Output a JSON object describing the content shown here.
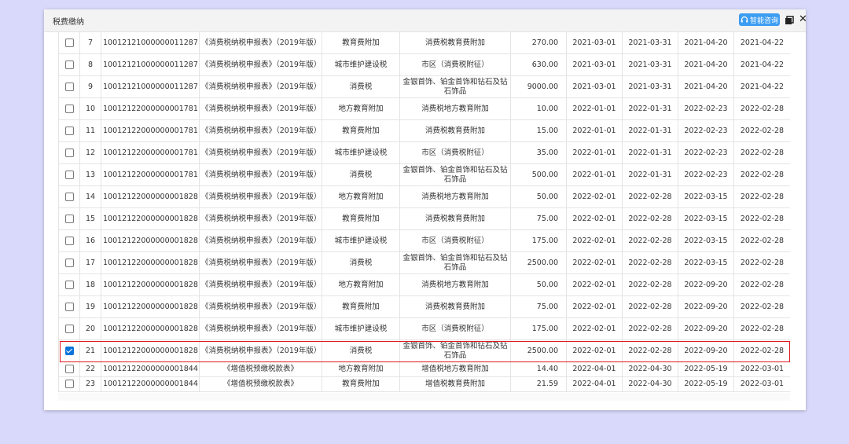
{
  "window": {
    "title": "税费缴纳",
    "ai_button_label": "智能咨询",
    "close_glyph": "✕"
  },
  "colors": {
    "highlight": "#e0191e",
    "accent": "#3d9df2",
    "background": "#d9d9fb"
  },
  "rows": [
    {
      "checked": false,
      "no": "7",
      "id": "10012121000000011287",
      "report": "《消费税纳税申报表》（2019年版）",
      "tax": "教育费附加",
      "item": "消费税教育费附加",
      "amount": "270.00",
      "start": "2021-03-01",
      "end": "2021-03-31",
      "deadline": "2021-04-20",
      "date": "2021-04-22"
    },
    {
      "checked": false,
      "no": "8",
      "id": "10012121000000011287",
      "report": "《消费税纳税申报表》（2019年版）",
      "tax": "城市维护建设税",
      "item": "市区（消费税附征）",
      "amount": "630.00",
      "start": "2021-03-01",
      "end": "2021-03-31",
      "deadline": "2021-04-20",
      "date": "2021-04-22"
    },
    {
      "checked": false,
      "no": "9",
      "id": "10012121000000011287",
      "report": "《消费税纳税申报表》（2019年版）",
      "tax": "消费税",
      "item": "金银首饰、铂金首饰和钻石及钻石饰品",
      "amount": "9000.00",
      "start": "2021-03-01",
      "end": "2021-03-31",
      "deadline": "2021-04-20",
      "date": "2021-04-22"
    },
    {
      "checked": false,
      "no": "10",
      "id": "10012122000000001781",
      "report": "《消费税纳税申报表》（2019年版）",
      "tax": "地方教育附加",
      "item": "消费税地方教育附加",
      "amount": "10.00",
      "start": "2022-01-01",
      "end": "2022-01-31",
      "deadline": "2022-02-23",
      "date": "2022-02-28"
    },
    {
      "checked": false,
      "no": "11",
      "id": "10012122000000001781",
      "report": "《消费税纳税申报表》（2019年版）",
      "tax": "教育费附加",
      "item": "消费税教育费附加",
      "amount": "15.00",
      "start": "2022-01-01",
      "end": "2022-01-31",
      "deadline": "2022-02-23",
      "date": "2022-02-28"
    },
    {
      "checked": false,
      "no": "12",
      "id": "10012122000000001781",
      "report": "《消费税纳税申报表》（2019年版）",
      "tax": "城市维护建设税",
      "item": "市区（消费税附征）",
      "amount": "35.00",
      "start": "2022-01-01",
      "end": "2022-01-31",
      "deadline": "2022-02-23",
      "date": "2022-02-28"
    },
    {
      "checked": false,
      "no": "13",
      "id": "10012122000000001781",
      "report": "《消费税纳税申报表》（2019年版）",
      "tax": "消费税",
      "item": "金银首饰、铂金首饰和钻石及钻石饰品",
      "amount": "500.00",
      "start": "2022-01-01",
      "end": "2022-01-31",
      "deadline": "2022-02-23",
      "date": "2022-02-28"
    },
    {
      "checked": false,
      "no": "14",
      "id": "10012122000000001828",
      "report": "《消费税纳税申报表》（2019年版）",
      "tax": "地方教育附加",
      "item": "消费税地方教育附加",
      "amount": "50.00",
      "start": "2022-02-01",
      "end": "2022-02-28",
      "deadline": "2022-03-15",
      "date": "2022-02-28"
    },
    {
      "checked": false,
      "no": "15",
      "id": "10012122000000001828",
      "report": "《消费税纳税申报表》（2019年版）",
      "tax": "教育费附加",
      "item": "消费税教育费附加",
      "amount": "75.00",
      "start": "2022-02-01",
      "end": "2022-02-28",
      "deadline": "2022-03-15",
      "date": "2022-02-28"
    },
    {
      "checked": false,
      "no": "16",
      "id": "10012122000000001828",
      "report": "《消费税纳税申报表》（2019年版）",
      "tax": "城市维护建设税",
      "item": "市区（消费税附征）",
      "amount": "175.00",
      "start": "2022-02-01",
      "end": "2022-02-28",
      "deadline": "2022-03-15",
      "date": "2022-02-28"
    },
    {
      "checked": false,
      "no": "17",
      "id": "10012122000000001828",
      "report": "《消费税纳税申报表》（2019年版）",
      "tax": "消费税",
      "item": "金银首饰、铂金首饰和钻石及钻石饰品",
      "amount": "2500.00",
      "start": "2022-02-01",
      "end": "2022-02-28",
      "deadline": "2022-03-15",
      "date": "2022-02-28"
    },
    {
      "checked": false,
      "no": "18",
      "id": "10012122000000001828",
      "report": "《消费税纳税申报表》（2019年版）",
      "tax": "地方教育附加",
      "item": "消费税地方教育附加",
      "amount": "50.00",
      "start": "2022-02-01",
      "end": "2022-02-28",
      "deadline": "2022-09-20",
      "date": "2022-02-28"
    },
    {
      "checked": false,
      "no": "19",
      "id": "10012122000000001828",
      "report": "《消费税纳税申报表》（2019年版）",
      "tax": "教育费附加",
      "item": "消费税教育费附加",
      "amount": "75.00",
      "start": "2022-02-01",
      "end": "2022-02-28",
      "deadline": "2022-09-20",
      "date": "2022-02-28"
    },
    {
      "checked": false,
      "no": "20",
      "id": "10012122000000001828",
      "report": "《消费税纳税申报表》（2019年版）",
      "tax": "城市维护建设税",
      "item": "市区（消费税附征）",
      "amount": "175.00",
      "start": "2022-02-01",
      "end": "2022-02-28",
      "deadline": "2022-09-20",
      "date": "2022-02-28"
    },
    {
      "checked": true,
      "no": "21",
      "id": "10012122000000001828",
      "report": "《消费税纳税申报表》（2019年版）",
      "tax": "消费税",
      "item": "金银首饰、铂金首饰和钻石及钻石饰品",
      "amount": "2500.00",
      "start": "2022-02-01",
      "end": "2022-02-28",
      "deadline": "2022-09-20",
      "date": "2022-02-28"
    },
    {
      "checked": false,
      "no": "22",
      "id": "10012122000000001844",
      "report": "《增值税预缴税款表》",
      "tax": "地方教育附加",
      "item": "增值税地方教育附加",
      "amount": "14.40",
      "start": "2022-04-01",
      "end": "2022-04-30",
      "deadline": "2022-05-19",
      "date": "2022-03-01"
    },
    {
      "checked": false,
      "no": "23",
      "id": "10012122000000001844",
      "report": "《增值税预缴税款表》",
      "tax": "教育费附加",
      "item": "增值税教育费附加",
      "amount": "21.59",
      "start": "2022-04-01",
      "end": "2022-04-30",
      "deadline": "2022-05-19",
      "date": "2022-03-01"
    }
  ]
}
